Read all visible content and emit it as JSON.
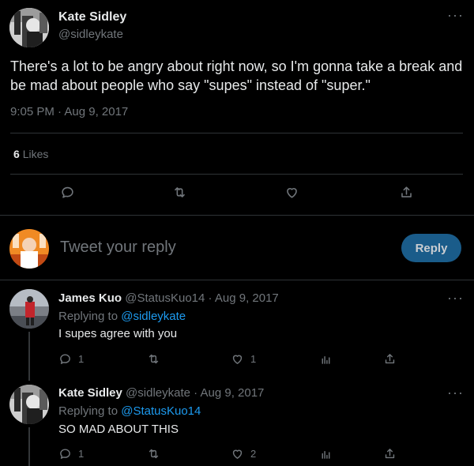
{
  "main_tweet": {
    "author_name": "Kate Sidley",
    "author_handle": "@sidleykate",
    "text": "There's a lot to be angry about right now, so I'm gonna take a break and be mad about people who say \"supes\" instead of \"super.\"",
    "timestamp": "9:05 PM · Aug 9, 2017",
    "likes_count": "6",
    "likes_label": "Likes",
    "more_icon": "more-horizontal-icon"
  },
  "reply_box": {
    "placeholder": "Tweet your reply",
    "button_label": "Reply"
  },
  "replies": [
    {
      "author_name": "James Kuo",
      "author_handle": "@StatusKuo14",
      "date": "· Aug 9, 2017",
      "replying_label": "Replying to",
      "replying_to": "@sidleykate",
      "text": "I supes agree with you",
      "reply_count": "1",
      "like_count": "1"
    },
    {
      "author_name": "Kate Sidley",
      "author_handle": "@sidleykate",
      "date": "· Aug 9, 2017",
      "replying_label": "Replying to",
      "replying_to": "@StatusKuo14",
      "text": "SO MAD ABOUT THIS",
      "reply_count": "1",
      "like_count": "2"
    }
  ],
  "colors": {
    "background": "#000000",
    "text": "#e7e9ea",
    "muted": "#71767b",
    "link": "#1d9bf0",
    "reply_button": "#1a5c8a",
    "divider": "#2f3336"
  }
}
